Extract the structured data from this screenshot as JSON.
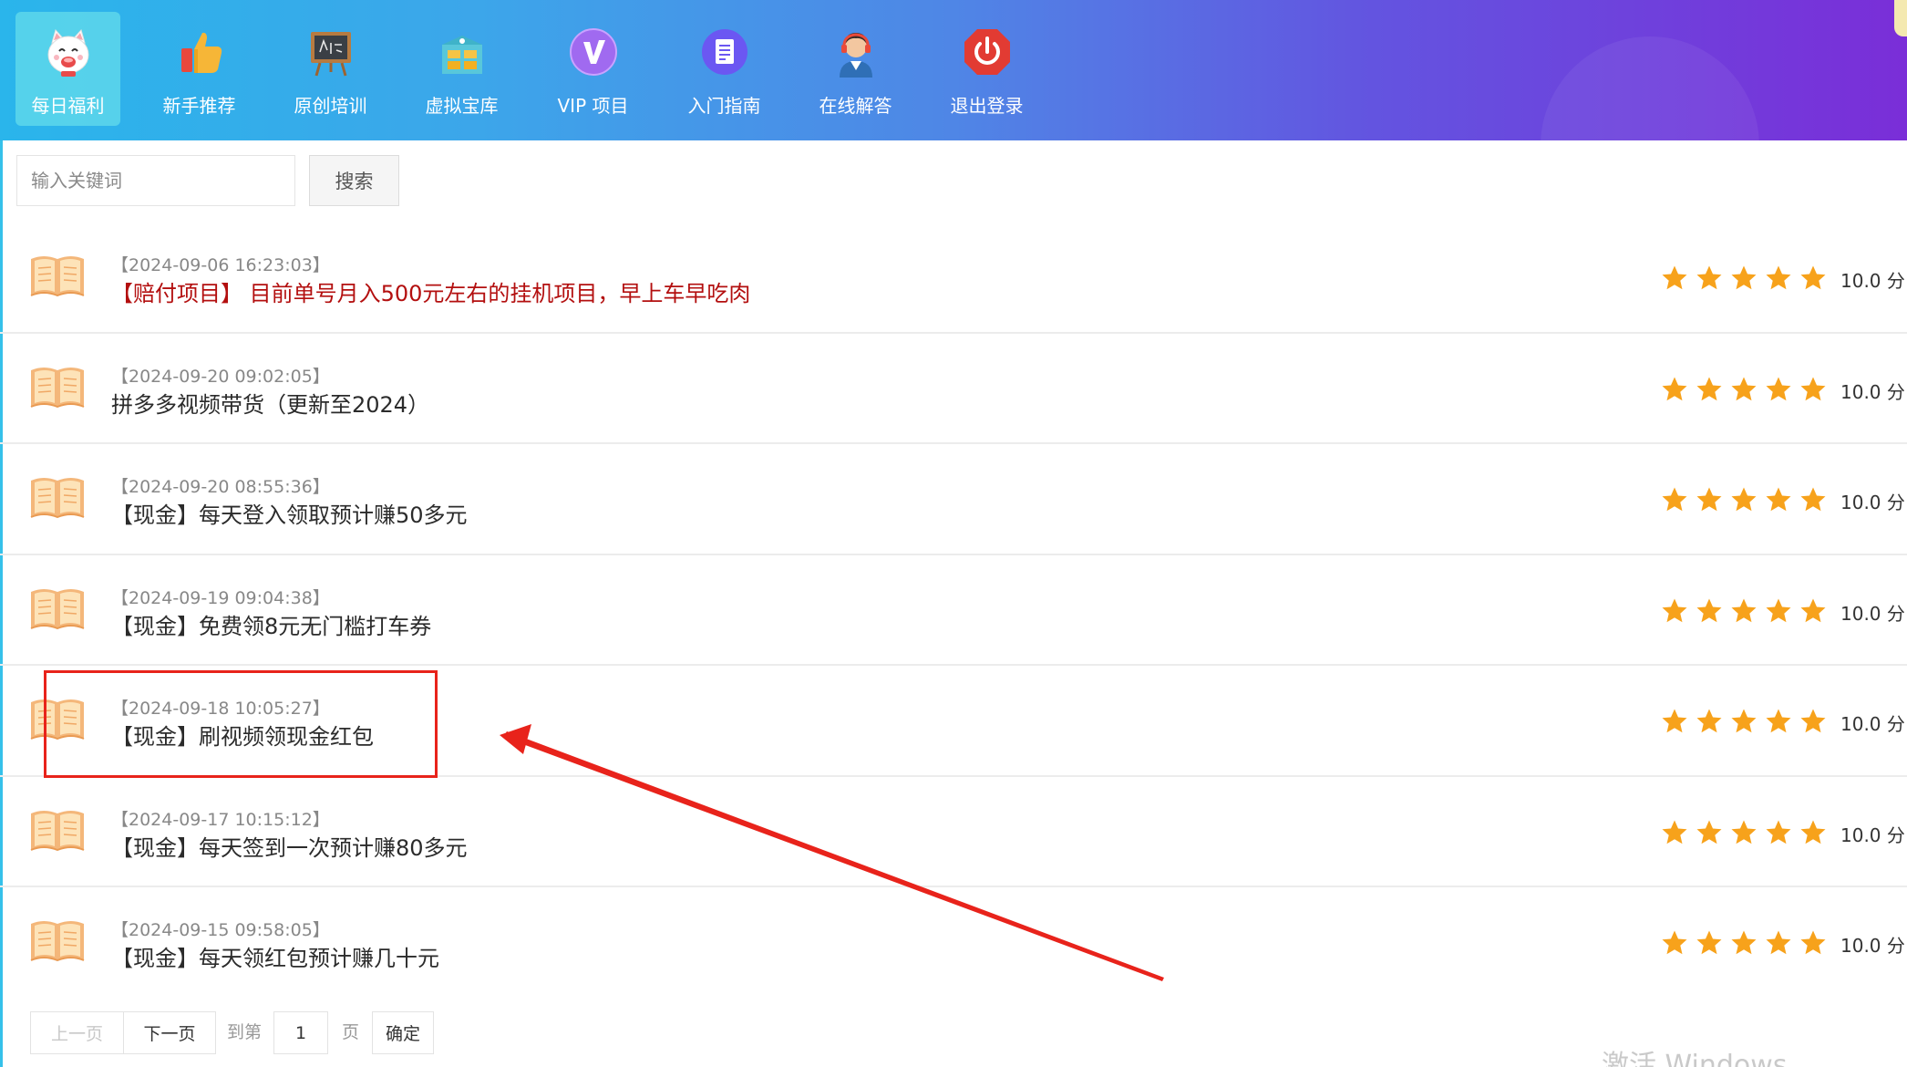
{
  "nav": {
    "items": [
      {
        "label": "每日福利",
        "icon": "lucky-cat-icon",
        "active": true
      },
      {
        "label": "新手推荐",
        "icon": "thumbs-up-icon",
        "active": false
      },
      {
        "label": "原创培训",
        "icon": "chalkboard-icon",
        "active": false
      },
      {
        "label": "虚拟宝库",
        "icon": "treasure-box-icon",
        "active": false
      },
      {
        "label": "VIP 项目",
        "icon": "vip-icon",
        "active": false
      },
      {
        "label": "入门指南",
        "icon": "document-icon",
        "active": false
      },
      {
        "label": "在线解答",
        "icon": "support-agent-icon",
        "active": false
      },
      {
        "label": "退出登录",
        "icon": "power-icon",
        "active": false
      }
    ]
  },
  "search": {
    "placeholder": "输入关键词",
    "value": "",
    "button_label": "搜索"
  },
  "list": {
    "items": [
      {
        "date": "【2024-09-06 16:23:03】",
        "title": "【赔付项目】 目前单号月入500元左右的挂机项目，早上车早吃肉",
        "rating": 5,
        "score": "10.0 分",
        "highlight": true
      },
      {
        "date": "【2024-09-20 09:02:05】",
        "title": "拼多多视频带货（更新至2024）",
        "rating": 5,
        "score": "10.0 分",
        "highlight": false
      },
      {
        "date": "【2024-09-20 08:55:36】",
        "title": "【现金】每天登入领取预计赚50多元",
        "rating": 5,
        "score": "10.0 分",
        "highlight": false
      },
      {
        "date": "【2024-09-19 09:04:38】",
        "title": "【现金】免费领8元无门槛打车券",
        "rating": 5,
        "score": "10.0 分",
        "highlight": false
      },
      {
        "date": "【2024-09-18 10:05:27】",
        "title": "【现金】刷视频领现金红包",
        "rating": 5,
        "score": "10.0 分",
        "highlight": false
      },
      {
        "date": "【2024-09-17 10:15:12】",
        "title": "【现金】每天签到一次预计赚80多元",
        "rating": 5,
        "score": "10.0 分",
        "highlight": false
      },
      {
        "date": "【2024-09-15 09:58:05】",
        "title": "【现金】每天领红包预计赚几十元",
        "rating": 5,
        "score": "10.0 分",
        "highlight": false
      }
    ]
  },
  "pagination": {
    "prev_label": "上一页",
    "next_label": "下一页",
    "goto_prefix": "到第",
    "page_value": "1",
    "goto_suffix": "页",
    "confirm_label": "确定"
  },
  "watermark": "激活 Windows",
  "colors": {
    "header_gradient_start": "#2ab5eb",
    "header_gradient_end": "#7a2ed8",
    "highlight_title": "#b30f0f",
    "star": "#f7a21b",
    "annotation": "#e8231b"
  }
}
